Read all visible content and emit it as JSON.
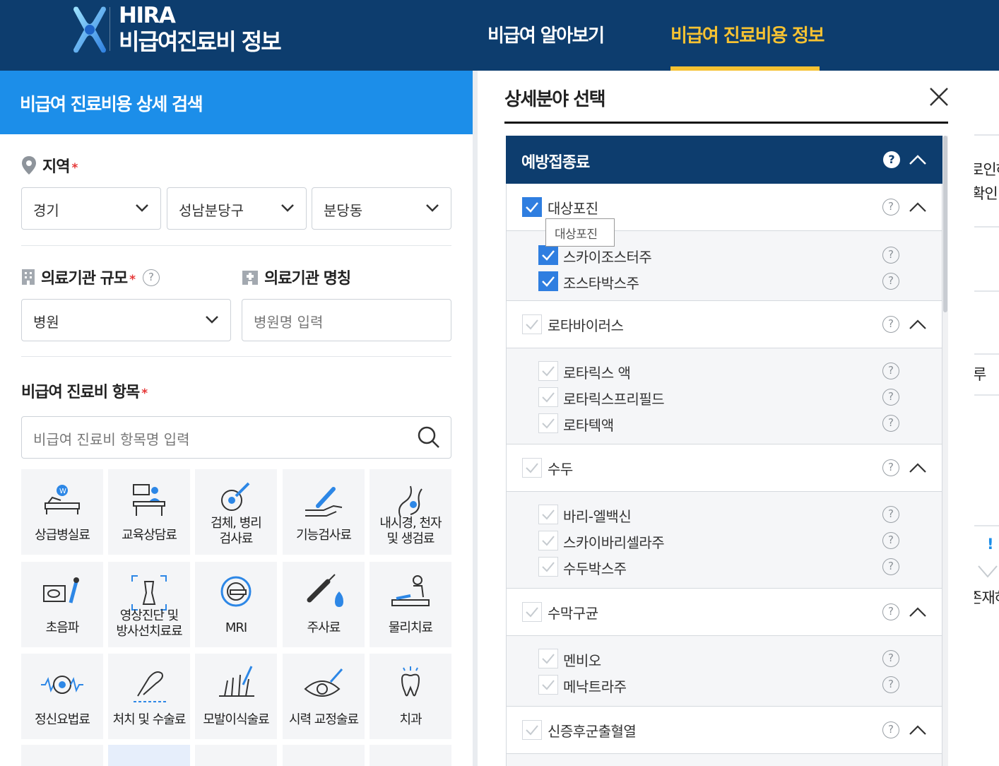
{
  "header": {
    "brand_top": "HIRA",
    "brand_bottom": "비급여진료비 정보",
    "nav": [
      "비급여 알아보기",
      "비급여 진료비용 정보"
    ],
    "active_color": "#f6c232"
  },
  "search": {
    "title": "비급여 진료비용 상세 검색",
    "region_label": "지역",
    "region": [
      "경기",
      "성남분당구",
      "분당동"
    ],
    "scale_label": "의료기관 규모",
    "scale_value": "병원",
    "name_label": "의료기관 명칭",
    "name_placeholder": "병원명 입력",
    "item_label": "비급여 진료비 항목",
    "item_placeholder": "비급여 진료비 항목명 입력",
    "required_mark": "*",
    "help_mark": "?",
    "categories": [
      [
        "상급병실료"
      ],
      [
        "교육상담료"
      ],
      [
        "검체, 병리",
        "검사료"
      ],
      [
        "기능검사료"
      ],
      [
        "내시경, 천자",
        "및 생검료"
      ],
      [
        "초음파"
      ],
      [
        "영상진단 및",
        "방사선치료료"
      ],
      [
        "MRI"
      ],
      [
        "주사료"
      ],
      [
        "물리치료"
      ],
      [
        "정신요법료"
      ],
      [
        "처치 및 수술료"
      ],
      [
        "모발이식술료"
      ],
      [
        "시력 교정술료"
      ],
      [
        "치과"
      ]
    ]
  },
  "panel": {
    "title": "상세분야 선택",
    "section": "예방접종료",
    "help_mark": "?",
    "tooltip": "대상포진",
    "groups": [
      {
        "name": "대상포진",
        "checked": true,
        "items": [
          {
            "name": "스카이조스터주",
            "checked": true
          },
          {
            "name": "조스타박스주",
            "checked": true
          }
        ]
      },
      {
        "name": "로타바이러스",
        "checked": false,
        "items": [
          {
            "name": "로타릭스 액",
            "checked": false
          },
          {
            "name": "로타릭스프리필드",
            "checked": false
          },
          {
            "name": "로타텍액",
            "checked": false
          }
        ]
      },
      {
        "name": "수두",
        "checked": false,
        "items": [
          {
            "name": "바리-엘백신",
            "checked": false
          },
          {
            "name": "스카이바리셀라주",
            "checked": false
          },
          {
            "name": "수두박스주",
            "checked": false
          }
        ]
      },
      {
        "name": "수막구균",
        "checked": false,
        "items": [
          {
            "name": "멘비오",
            "checked": false
          },
          {
            "name": "메낙트라주",
            "checked": false
          }
        ]
      },
      {
        "name": "신증후군출혈열",
        "checked": false,
        "items": []
      }
    ],
    "accent_color": "#0d3d6e",
    "check_color": "#2f7ee0"
  },
  "right_strip": {
    "texts": [
      "로인하",
      "확인",
      "루",
      "!",
      "존재하"
    ]
  }
}
